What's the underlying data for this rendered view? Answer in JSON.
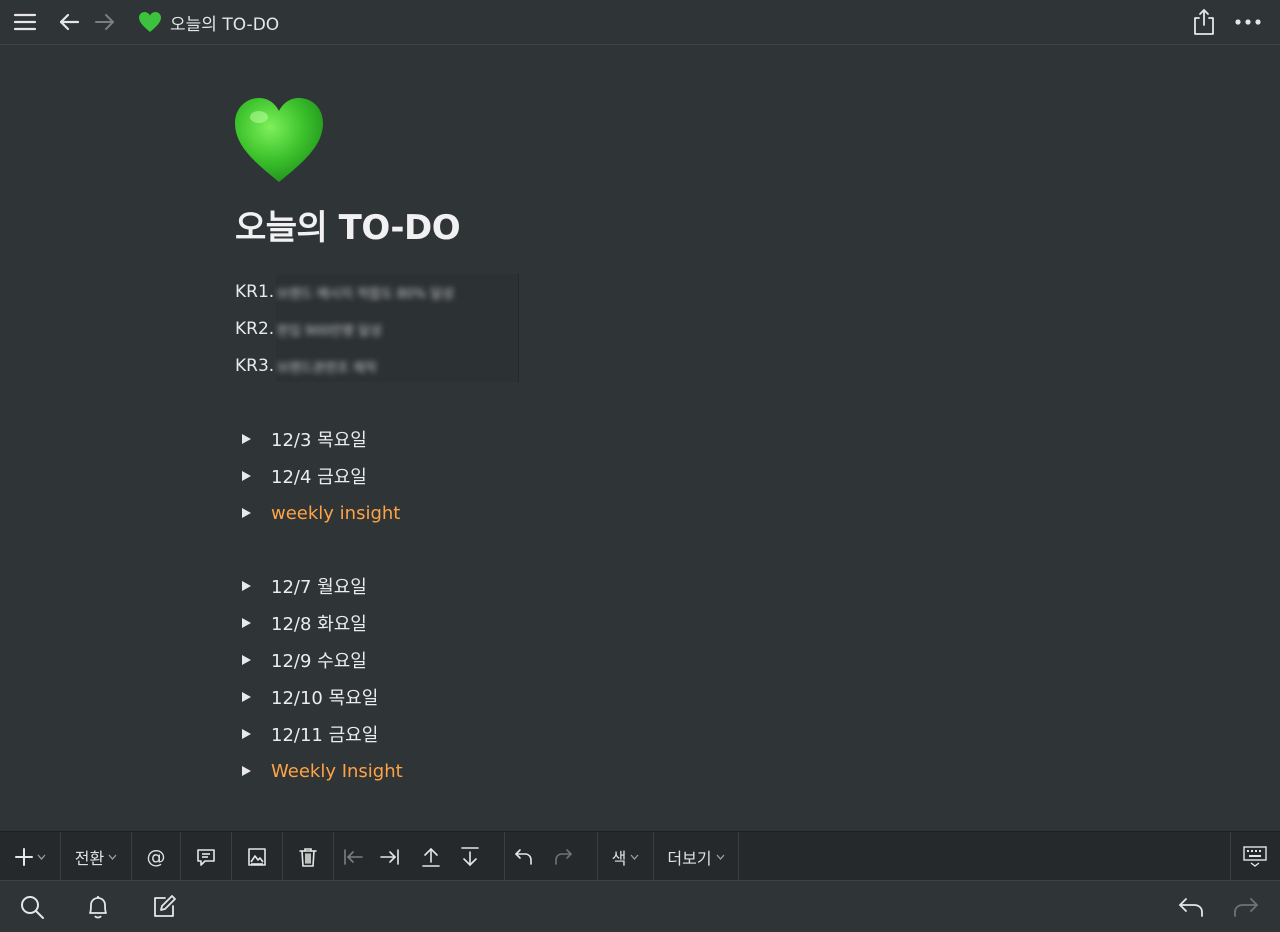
{
  "breadcrumb": {
    "icon": "green-heart-icon",
    "title": "오늘의 TO-DO"
  },
  "page": {
    "icon": "green-heart-icon",
    "title": "오늘의 TO-DO",
    "key_results": [
      {
        "label": "KR1.",
        "text": "브랜드 메시지 적합도 80% 달성"
      },
      {
        "label": "KR2.",
        "text": "판입 900만명 달성"
      },
      {
        "label": "KR3.",
        "text": "브랜드관련조 제작"
      }
    ],
    "toggles_week1": [
      {
        "text": "12/3 목요일",
        "color": "#ececec"
      },
      {
        "text": "12/4 금요일",
        "color": "#ececec"
      },
      {
        "text": "weekly insight",
        "color": "#ffa344"
      }
    ],
    "toggles_week2": [
      {
        "text": "12/7 월요일",
        "color": "#ececec"
      },
      {
        "text": "12/8 화요일",
        "color": "#ececec"
      },
      {
        "text": "12/9 수요일",
        "color": "#ececec"
      },
      {
        "text": "12/10 목요일",
        "color": "#ececec"
      },
      {
        "text": "12/11 금요일",
        "color": "#ececec"
      },
      {
        "text": "Weekly Insight",
        "color": "#ffa344"
      }
    ]
  },
  "edit_toolbar": {
    "turn_into_label": "전환",
    "mention_label": "@",
    "color_label": "색",
    "more_label": "더보기"
  },
  "colors": {
    "background": "#2f3437",
    "accent_orange": "#ffa344",
    "toolbar_bg": "#25292b"
  }
}
